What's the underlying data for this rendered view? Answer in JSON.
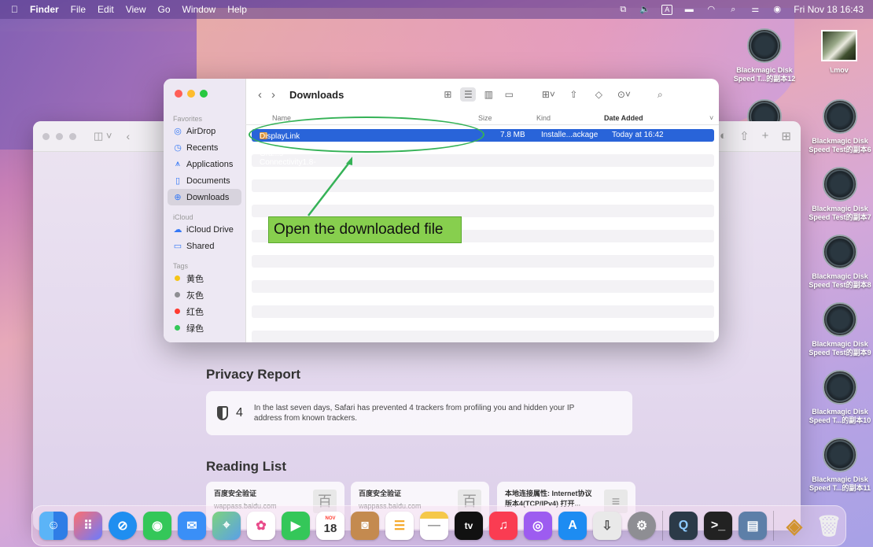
{
  "menubar": {
    "apple": "",
    "app": "Finder",
    "items": [
      "File",
      "Edit",
      "View",
      "Go",
      "Window",
      "Help"
    ],
    "input_indicator": "A",
    "clock": "Fri Nov 18  16:43"
  },
  "finder": {
    "title": "Downloads",
    "sidebar": {
      "favorites_header": "Favorites",
      "favorites": [
        {
          "label": "AirDrop",
          "icon": "airdrop-icon",
          "glyph": "◎"
        },
        {
          "label": "Recents",
          "icon": "clock-icon",
          "glyph": "◷"
        },
        {
          "label": "Applications",
          "icon": "applications-icon",
          "glyph": "⩚"
        },
        {
          "label": "Documents",
          "icon": "document-icon",
          "glyph": "▯"
        },
        {
          "label": "Downloads",
          "icon": "download-icon",
          "glyph": "⊕"
        }
      ],
      "icloud_header": "iCloud",
      "icloud": [
        {
          "label": "iCloud Drive",
          "icon": "cloud-icon",
          "glyph": "☁"
        },
        {
          "label": "Shared",
          "icon": "shared-folder-icon",
          "glyph": "▭"
        }
      ],
      "tags_header": "Tags",
      "tags": [
        {
          "label": "黄色",
          "color": "#f5c518"
        },
        {
          "label": "灰色",
          "color": "#8e8e93"
        },
        {
          "label": "红色",
          "color": "#ff3b30"
        },
        {
          "label": "绿色",
          "color": "#34c759"
        }
      ]
    },
    "columns": {
      "name": "Name",
      "size": "Size",
      "kind": "Kind",
      "date": "Date Added"
    },
    "file": {
      "name": "DisplayLink Manager Gra...s Connectivity1.8-EXE.pkg",
      "size": "7.8 MB",
      "kind": "Installe...ackage",
      "date": "Today at 16:42"
    }
  },
  "annotation": {
    "callout": "Open the downloaded file",
    "color": "#35b257"
  },
  "safari": {
    "privacy_title": "Privacy Report",
    "tracker_count": "4",
    "privacy_text": "In the last seven days, Safari has prevented 4 trackers from profiling you and hidden your IP address from known trackers.",
    "reading_title": "Reading List",
    "reading_items": [
      {
        "title": "百度安全验证",
        "url": "wappass.baidu.com",
        "thumb": "百"
      },
      {
        "title": "百度安全验证",
        "url": "wappass.baidu.com",
        "thumb": "百"
      },
      {
        "title": "本地连接属性: Internet协议版本4(TCP/IPv4) 打开...",
        "url": "",
        "thumb": "≡"
      }
    ]
  },
  "desktop": {
    "icons_col1": [
      {
        "label": "Blackmagic Disk Speed T...的副本12"
      },
      {
        "label": ""
      }
    ],
    "mov": {
      "label": "\\.mov"
    },
    "icons_col2": [
      {
        "label": "Blackmagic Disk Speed Test的副本6"
      },
      {
        "label": "Blackmagic Disk Speed Test的副本7"
      },
      {
        "label": "Blackmagic Disk Speed Test的副本8"
      },
      {
        "label": "Blackmagic Disk Speed Test的副本9"
      },
      {
        "label": "Blackmagic Disk Speed T...的副本10"
      },
      {
        "label": "Blackmagic Disk Speed T...的副本11"
      }
    ]
  },
  "dock": {
    "calendar_month": "NOV",
    "calendar_day": "18",
    "tv_label": "tv"
  }
}
